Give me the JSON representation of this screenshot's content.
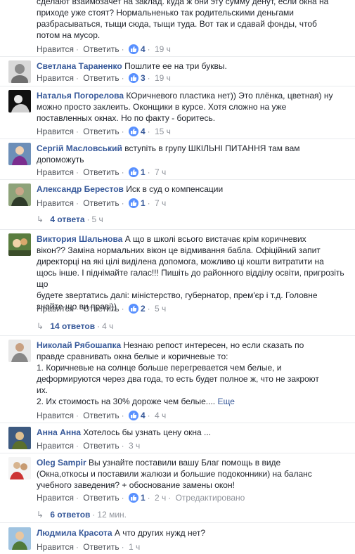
{
  "comments": [
    {
      "author": "",
      "text_lines": [
        "сделают взаимозачет на заклад. куда ж они эту сумму денут, если окна на",
        "приходе уже стоят? Нормальненько так родительскими деньгами",
        "разбрасываться, тыщи сюда, тыщи туда. Вот так и сдавай фонды, чтоб",
        "потом на мусор."
      ],
      "like_label": "Нравится",
      "reply_label": "Ответить",
      "likes": "4",
      "time": "19 ч"
    },
    {
      "author": "Светлана Тараненко",
      "text_lines": [
        "Пошлите ее на три буквы."
      ],
      "like_label": "Нравится",
      "reply_label": "Ответить",
      "likes": "3",
      "time": "19 ч"
    },
    {
      "author": "Наталья Погорелова",
      "text_lines": [
        "КОричневого пластика нет)) Это плёнка, цветная) ну",
        "можно просто заклеить. Оконщики в курсе. Хотя сложно на уже",
        "поставленных окнах. Но по факту - боритесь."
      ],
      "like_label": "Нравится",
      "reply_label": "Ответить",
      "likes": "4",
      "time": "15 ч"
    },
    {
      "author": "Сергій Масловський",
      "text_lines": [
        "вступіть в групу ШКІЛЬНІ ПИТАННЯ там вам",
        "допоможуть"
      ],
      "like_label": "Нравится",
      "reply_label": "Ответить",
      "likes": "1",
      "time": "7 ч"
    },
    {
      "author": "Александр Берестов",
      "text_lines": [
        "Иск в суд о компенсации"
      ],
      "like_label": "Нравится",
      "reply_label": "Ответить",
      "likes": "1",
      "time": "7 ч",
      "replies_label": "4 ответа",
      "replies_time": "5 ч"
    },
    {
      "author": "Виктория Шальнова",
      "text_lines": [
        "А що в школі всього вистачає крім коричневих",
        "вікон?? Заміна нормальних вікон це відмивання бабла. Офіційний запит",
        "директорці на які цілі виділена допомога, можливо ці кошти витратити на",
        "щось інше. І піднімайте галас!!! Пишіть до районного відділу освіти, пригрозіть що",
        "будете звертатись далі: міністерство, губернатор, прем'єр і т.д. Головне",
        "знайте що ви праві))"
      ],
      "like_label": "Нравится",
      "reply_label": "Ответить",
      "likes": "2",
      "time": "5 ч",
      "replies_label": "14 ответов",
      "replies_time": "4 ч"
    },
    {
      "author": "Николай Рябошапка",
      "text_lines": [
        "Незнаю репост интересен, но если сказать по",
        "правде сравнивать окна белые и коричневые то:",
        "1. Коричневые на солнце больше перегревается чем белые, и",
        "деформируются через два года, то есть будет полное ж, что не закроют",
        "их.",
        "2. Их стоимость на 30% дороже чем белые...."
      ],
      "see_more": "Еще",
      "like_label": "Нравится",
      "reply_label": "Ответить",
      "likes": "4",
      "time": "4 ч"
    },
    {
      "author": "Анна Анна",
      "text_lines": [
        "Хотелось бы узнать цену окна ..."
      ],
      "like_label": "Нравится",
      "reply_label": "Ответить",
      "time": "3 ч"
    },
    {
      "author": "Oleg Sampir",
      "text_lines": [
        "Вы узнайте поставили вашу Благ помощь в виде",
        "(Окна,откосы и поставили жалюзи и большие подоконники) на баланс",
        "учебного заведения? + обоснование замены окон!"
      ],
      "like_label": "Нравится",
      "reply_label": "Ответить",
      "likes": "1",
      "time": "2 ч",
      "edited": "Отредактировано",
      "replies_label": "6 ответов",
      "replies_time": "12 мин."
    },
    {
      "author": "Людмила Красота",
      "text_lines": [
        "А что других нужд нет?"
      ],
      "like_label": "Нравится",
      "reply_label": "Ответить",
      "time": "1 ч"
    }
  ],
  "colors": {
    "author": "#365899",
    "text": "#1d2129",
    "meta": "#90949c",
    "like_badge": "#5890ff"
  },
  "icons": {
    "like": "thumbs-up-icon",
    "reply": "reply-arrow-icon"
  }
}
